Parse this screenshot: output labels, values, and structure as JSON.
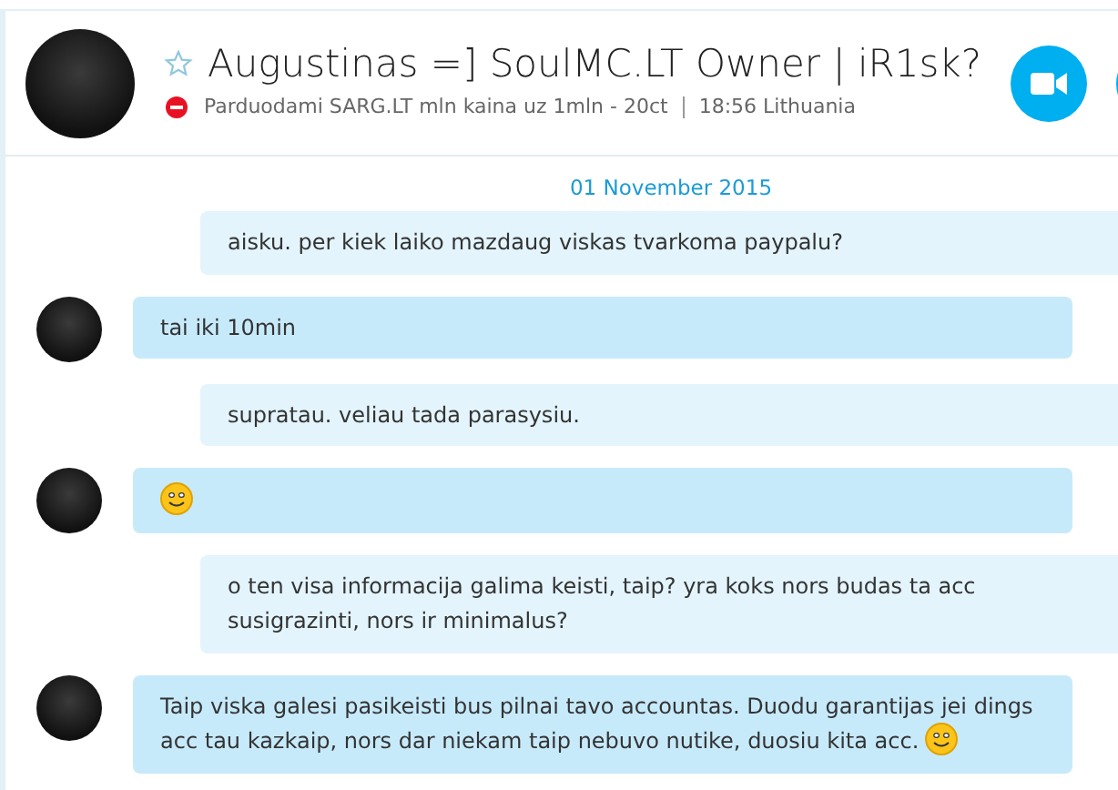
{
  "contact": {
    "name": "Augustinas =] SoulMC.LT Owner | iR1sk?",
    "favorite": false,
    "busy": true,
    "mood": "Parduodami SARG.LT mln kaina uz 1mln - 20ct",
    "local_time": "18:56 Lithuania"
  },
  "date_divider": "01 November 2015",
  "messages": [
    {
      "kind": "sent",
      "text": "aisku. per kiek laiko mazdaug viskas tvarkoma paypalu?",
      "emoji": false
    },
    {
      "kind": "received",
      "text": "tai iki 10min",
      "emoji": false
    },
    {
      "kind": "sent",
      "text": "supratau. veliau tada parasysiu.",
      "emoji": false
    },
    {
      "kind": "received",
      "emoji": true
    },
    {
      "kind": "sent",
      "text": "o ten visa informacija galima keisti, taip? yra koks nors budas ta acc susigrazinti, nors ir minimalus?",
      "emoji": false
    },
    {
      "kind": "received",
      "text": "Taip viska galesi pasikeisti bus pilnai tavo accountas. Duodu garantijas jei dings acc tau kazkaip, nors dar niekam taip nebuvo nutike, duosiu kita acc.",
      "emoji": true
    }
  ]
}
